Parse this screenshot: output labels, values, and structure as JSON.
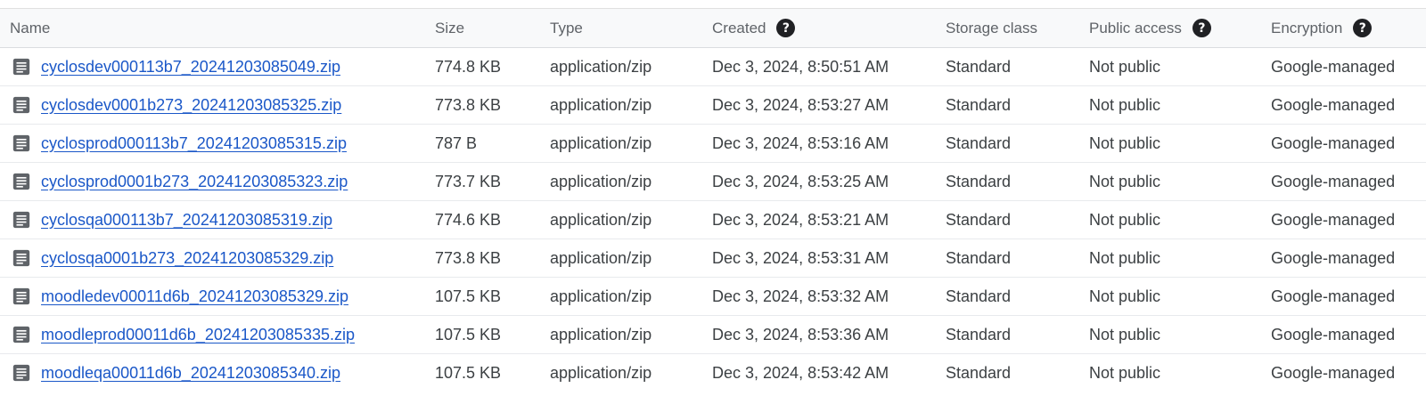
{
  "header": {
    "name": "Name",
    "size": "Size",
    "type": "Type",
    "created": "Created",
    "storage_class": "Storage class",
    "public_access": "Public access",
    "encryption": "Encryption",
    "help_glyph": "?"
  },
  "rows": [
    {
      "name": "cyclosdev000113b7_20241203085049.zip",
      "size": "774.8 KB",
      "type": "application/zip",
      "created": "Dec 3, 2024, 8:50:51 AM",
      "storage": "Standard",
      "public": "Not public",
      "encryption": "Google-managed"
    },
    {
      "name": "cyclosdev0001b273_20241203085325.zip",
      "size": "773.8 KB",
      "type": "application/zip",
      "created": "Dec 3, 2024, 8:53:27 AM",
      "storage": "Standard",
      "public": "Not public",
      "encryption": "Google-managed"
    },
    {
      "name": "cyclosprod000113b7_20241203085315.zip",
      "size": "787 B",
      "type": "application/zip",
      "created": "Dec 3, 2024, 8:53:16 AM",
      "storage": "Standard",
      "public": "Not public",
      "encryption": "Google-managed"
    },
    {
      "name": "cyclosprod0001b273_20241203085323.zip",
      "size": "773.7 KB",
      "type": "application/zip",
      "created": "Dec 3, 2024, 8:53:25 AM",
      "storage": "Standard",
      "public": "Not public",
      "encryption": "Google-managed"
    },
    {
      "name": "cyclosqa000113b7_20241203085319.zip",
      "size": "774.6 KB",
      "type": "application/zip",
      "created": "Dec 3, 2024, 8:53:21 AM",
      "storage": "Standard",
      "public": "Not public",
      "encryption": "Google-managed"
    },
    {
      "name": "cyclosqa0001b273_20241203085329.zip",
      "size": "773.8 KB",
      "type": "application/zip",
      "created": "Dec 3, 2024, 8:53:31 AM",
      "storage": "Standard",
      "public": "Not public",
      "encryption": "Google-managed"
    },
    {
      "name": "moodledev00011d6b_20241203085329.zip",
      "size": "107.5 KB",
      "type": "application/zip",
      "created": "Dec 3, 2024, 8:53:32 AM",
      "storage": "Standard",
      "public": "Not public",
      "encryption": "Google-managed"
    },
    {
      "name": "moodleprod00011d6b_20241203085335.zip",
      "size": "107.5 KB",
      "type": "application/zip",
      "created": "Dec 3, 2024, 8:53:36 AM",
      "storage": "Standard",
      "public": "Not public",
      "encryption": "Google-managed"
    },
    {
      "name": "moodleqa00011d6b_20241203085340.zip",
      "size": "107.5 KB",
      "type": "application/zip",
      "created": "Dec 3, 2024, 8:53:42 AM",
      "storage": "Standard",
      "public": "Not public",
      "encryption": "Google-managed"
    }
  ],
  "icons": {
    "file": "document-file-icon",
    "help": "help-circle-icon"
  },
  "colors": {
    "link": "#1a57c8",
    "header_bg": "#f8f9fa",
    "text": "#3c4043",
    "icon": "#5f6368"
  }
}
